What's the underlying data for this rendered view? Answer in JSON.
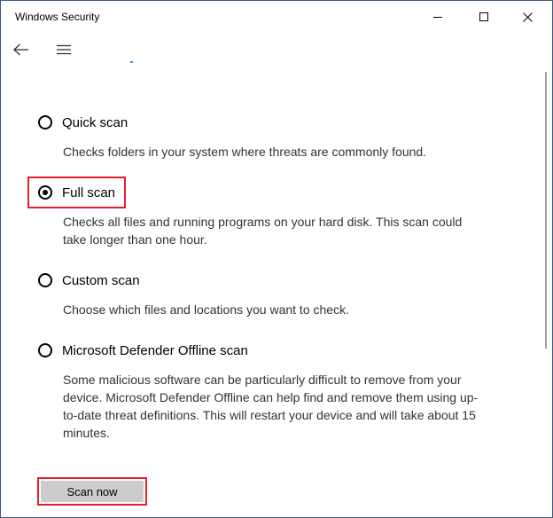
{
  "window": {
    "title": "Windows Security"
  },
  "icons": {
    "back": "back-arrow-icon",
    "menu": "hamburger-menu-icon",
    "minimize": "minimize-icon",
    "maximize": "maximize-icon",
    "close": "close-icon"
  },
  "colors": {
    "highlight": "#e0202a",
    "radio_selected": "#000000",
    "button_bg": "#cccccc"
  },
  "scan_options": [
    {
      "label": "Quick scan",
      "description": "Checks folders in your system where threats are commonly found.",
      "selected": false
    },
    {
      "label": "Full scan",
      "description": "Checks all files and running programs on your hard disk. This scan could take longer than one hour.",
      "selected": true
    },
    {
      "label": "Custom scan",
      "description": "Choose which files and locations you want to check.",
      "selected": false
    },
    {
      "label": "Microsoft Defender Offline scan",
      "description": "Some malicious software can be particularly difficult to remove from your device. Microsoft Defender Offline can help find and remove them using up-to-date threat definitions. This will restart your device and will take about 15 minutes.",
      "selected": false
    }
  ],
  "actions": {
    "scan_now_label": "Scan now"
  }
}
